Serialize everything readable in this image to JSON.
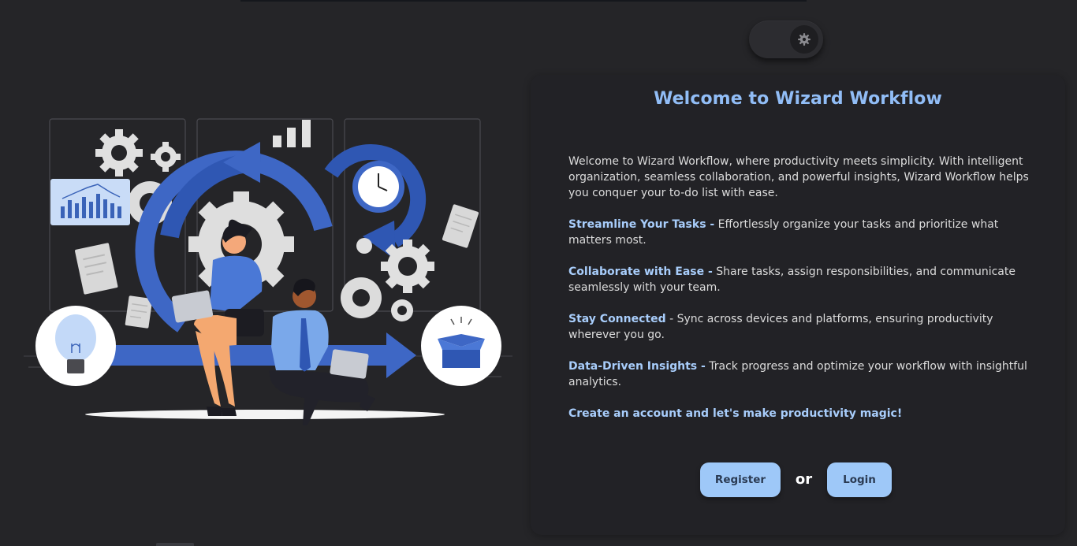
{
  "theme_toggle": {
    "icon": "gear-icon",
    "state": "dark"
  },
  "illustration": {
    "description_icon": "productivity-illustration"
  },
  "welcome": {
    "title": "Welcome to Wizard Workflow",
    "intro": "Welcome to Wizard Workflow, where productivity meets simplicity. With intelligent organization, seamless collaboration, and powerful insights, Wizard Workflow helps you conquer your to-do list with ease.",
    "features": [
      {
        "title": "Streamline Your Tasks -",
        "text": " Effortlessly organize your tasks and prioritize what matters most."
      },
      {
        "title": "Collaborate with Ease -",
        "text": " Share tasks, assign responsibilities, and communicate seamlessly with your team."
      },
      {
        "title": "Stay Connected",
        "text": " - Sync across devices and platforms, ensuring productivity wherever you go."
      },
      {
        "title": "Data-Driven Insights -",
        "text": " Track progress and optimize your workflow with insightful analytics."
      }
    ],
    "cta": "Create an account and let's make productivity magic!"
  },
  "actions": {
    "register_label": "Register",
    "or_label": "or",
    "login_label": "Login"
  },
  "colors": {
    "accent": "#91bdf6",
    "button_bg": "#9ec8f8",
    "background": "#252528",
    "card_bg": "#222226"
  }
}
